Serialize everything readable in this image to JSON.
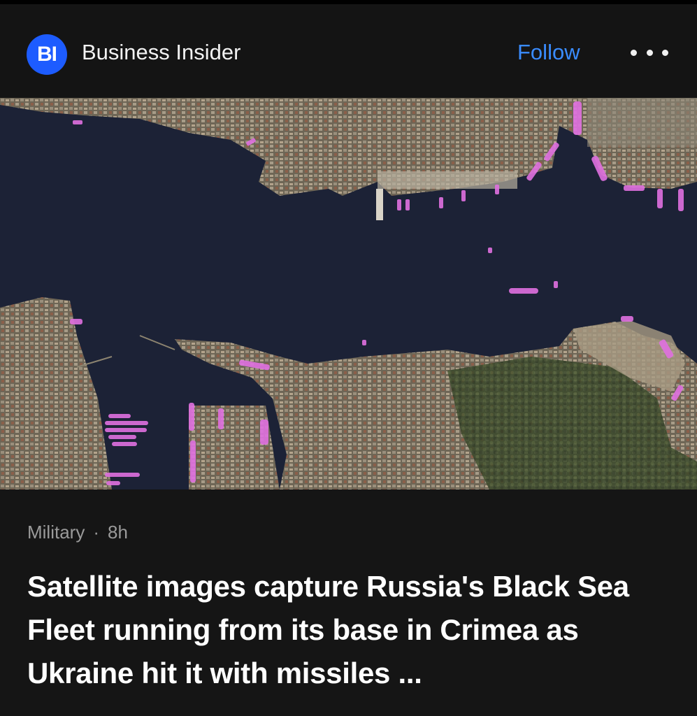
{
  "header": {
    "logo_text": "BI",
    "publisher_name": "Business Insider",
    "follow_label": "Follow",
    "more_icon": "more-horizontal-icon"
  },
  "article": {
    "image_icon": "satellite-photo",
    "category": "Military",
    "separator": "·",
    "time_ago": "8h",
    "headline": "Satellite images capture Russia's Black Sea Fleet running from its base in Crimea as Ukraine hit it with missiles ..."
  },
  "colors": {
    "background": "#151515",
    "accent_follow": "#3a8cff",
    "logo_bg": "#1d5cff",
    "ship_highlight": "#e070e0"
  }
}
